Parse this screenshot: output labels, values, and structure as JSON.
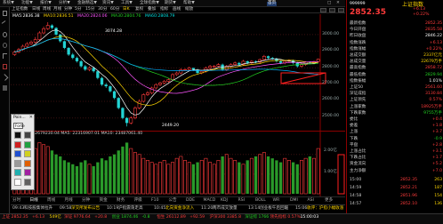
{
  "menu": {
    "items": [
      "系统▼",
      "功能▼",
      "报价▼",
      "分析▼",
      "金融精选▼",
      "资讯▼",
      "工具▼",
      "全球指数▼",
      "期货▼",
      "帮助▼"
    ],
    "active_label": "首页",
    "window_buttons": [
      "□",
      "✕"
    ]
  },
  "toolbar": {
    "stock_label": "上证指数",
    "buttons": [
      "日线",
      "周线",
      "月线",
      "分钟",
      "5分",
      "15分",
      "30分",
      "60分",
      "日K",
      "复权",
      "叠加",
      "指标",
      "画线",
      "缩放"
    ],
    "selected_index": 8
  },
  "main_chart": {
    "header": [
      "MA5:2836.38",
      "MA10:2836.51",
      "MA20:2824.06",
      "MA30:2804.76",
      "MA60:2808.79"
    ],
    "high_label": "3074.28",
    "low_label": "2449.20",
    "price_axis": [
      "3000.00",
      "2900.00",
      "2800.00",
      "2700.00",
      "2600.00",
      "2500.00",
      "2449.20"
    ]
  },
  "volume_chart": {
    "header": "VOLUME: 22679230.04  MA5: 22316907.01  MA10: 23487061.40",
    "axis": [
      "2.00亿",
      "1.00亿"
    ]
  },
  "chart_data": {
    "type": "candlestick",
    "title": "上证指数",
    "ylim": [
      2440,
      3090
    ],
    "open": [
      2880,
      2895,
      2910,
      2930,
      2945,
      2955,
      2970,
      3010,
      3035,
      3055,
      3040,
      3000,
      2960,
      2920,
      2880,
      2860,
      2840,
      2810,
      2790,
      2800,
      2780,
      2740,
      2700,
      2690,
      2660,
      2620,
      2560,
      2500,
      2470,
      2500,
      2560,
      2600,
      2640,
      2650,
      2680,
      2700,
      2710,
      2720,
      2730,
      2760,
      2770,
      2790,
      2790,
      2800,
      2790,
      2770,
      2780,
      2800,
      2810,
      2810,
      2820,
      2790,
      2810,
      2820,
      2830,
      2820,
      2840,
      2830,
      2840,
      2835,
      2850,
      2870,
      2860,
      2855,
      2840,
      2830,
      2840,
      2845,
      2830,
      2810,
      2820,
      2835,
      2830,
      2838
    ],
    "close": [
      2895,
      2910,
      2930,
      2945,
      2955,
      2970,
      3010,
      3035,
      3055,
      3040,
      3000,
      2960,
      2920,
      2880,
      2860,
      2840,
      2810,
      2790,
      2800,
      2780,
      2740,
      2700,
      2690,
      2660,
      2620,
      2560,
      2500,
      2470,
      2500,
      2560,
      2600,
      2640,
      2650,
      2680,
      2700,
      2710,
      2720,
      2730,
      2760,
      2770,
      2790,
      2790,
      2800,
      2790,
      2770,
      2780,
      2800,
      2810,
      2810,
      2820,
      2790,
      2810,
      2820,
      2830,
      2820,
      2840,
      2830,
      2840,
      2835,
      2850,
      2870,
      2860,
      2855,
      2840,
      2830,
      2840,
      2845,
      2830,
      2810,
      2820,
      2835,
      2830,
      2838,
      2852
    ],
    "high": [
      2905,
      2920,
      2940,
      2955,
      2965,
      2985,
      3020,
      3048,
      3074,
      3062,
      3045,
      3005,
      2965,
      2925,
      2890,
      2868,
      2848,
      2818,
      2810,
      2808,
      2785,
      2748,
      2710,
      2695,
      2665,
      2625,
      2565,
      2505,
      2510,
      2570,
      2612,
      2648,
      2662,
      2688,
      2708,
      2718,
      2728,
      2738,
      2768,
      2778,
      2798,
      2798,
      2808,
      2800,
      2795,
      2788,
      2808,
      2818,
      2818,
      2828,
      2826,
      2818,
      2828,
      2838,
      2836,
      2848,
      2844,
      2846,
      2845,
      2856,
      2878,
      2874,
      2866,
      2860,
      2846,
      2846,
      2852,
      2850,
      2836,
      2826,
      2840,
      2840,
      2844,
      2856
    ],
    "low": [
      2872,
      2888,
      2902,
      2922,
      2938,
      2948,
      2962,
      3002,
      3028,
      3032,
      2994,
      2952,
      2912,
      2872,
      2852,
      2832,
      2802,
      2782,
      2780,
      2772,
      2732,
      2692,
      2680,
      2652,
      2612,
      2552,
      2492,
      2449,
      2462,
      2492,
      2552,
      2592,
      2632,
      2642,
      2672,
      2692,
      2702,
      2712,
      2722,
      2752,
      2762,
      2782,
      2782,
      2782,
      2762,
      2762,
      2772,
      2792,
      2802,
      2802,
      2782,
      2782,
      2802,
      2812,
      2812,
      2812,
      2822,
      2822,
      2828,
      2828,
      2842,
      2852,
      2848,
      2832,
      2822,
      2822,
      2832,
      2822,
      2802,
      2802,
      2812,
      2822,
      2822,
      2830
    ],
    "volume": [
      1.6,
      1.7,
      1.8,
      1.9,
      2.1,
      2.3,
      2.6,
      2.5,
      2.4,
      2.2,
      2.0,
      1.9,
      1.7,
      1.6,
      1.5,
      1.4,
      1.6,
      1.7,
      1.5,
      1.4,
      1.6,
      1.8,
      1.7,
      1.9,
      2.0,
      2.2,
      2.4,
      2.6,
      2.3,
      2.1,
      2.0,
      1.8,
      1.7,
      1.6,
      1.5,
      1.6,
      1.7,
      1.5,
      1.6,
      1.8,
      1.9,
      1.7,
      1.6,
      1.5,
      1.6,
      1.7,
      1.8,
      1.6,
      1.5,
      1.7,
      1.9,
      2.0,
      1.8,
      1.7,
      1.6,
      1.5,
      1.7,
      1.8,
      1.9,
      2.0,
      2.1,
      1.9,
      1.8,
      1.7,
      1.6,
      1.8,
      1.7,
      1.6,
      1.5,
      1.7,
      1.8,
      1.9,
      1.8,
      2.3
    ]
  },
  "right_panel": {
    "code": "999999",
    "name": "上证指数",
    "price": "2852.35",
    "change": "+6.13",
    "change_pct": "+0.22%",
    "rows": [
      {
        "k": "最新指数",
        "v": "2852.35",
        "c": "up"
      },
      {
        "k": "今日开盘",
        "v": "2835.58",
        "c": "up"
      },
      {
        "k": "昨日收盘",
        "v": "2846.22",
        "c": "wh"
      },
      {
        "k": "指数涨跌",
        "v": "+6.13",
        "c": "up"
      },
      {
        "k": "指数涨幅",
        "v": "+0.22%",
        "c": "up"
      },
      {
        "k": "总成交额",
        "v": "2337亿元",
        "c": "yl"
      },
      {
        "k": "总成交量",
        "v": "22679万手",
        "c": "yl"
      },
      {
        "k": "最高指数",
        "v": "2858.72",
        "c": "up"
      },
      {
        "k": "最低指数",
        "v": "2829.94",
        "c": "dn"
      },
      {
        "k": "指数振幅",
        "v": "1.01%",
        "c": "wh"
      },
      {
        "k": "上证50",
        "v": "2561.60",
        "c": "up"
      },
      {
        "k": "深证成指",
        "v": "3130.84",
        "c": "up"
      },
      {
        "k": "上证领先",
        "v": "0.57%",
        "c": "up"
      },
      {
        "k": "上涨家数",
        "v": "18925万手",
        "c": "up"
      },
      {
        "k": "下跌家数",
        "v": "9755万手",
        "c": "dn"
      },
      {
        "k": "委比",
        "v": "+0.4",
        "c": "up"
      },
      {
        "k": "委差",
        "v": "+1.8",
        "c": "up"
      },
      {
        "k": "上涨",
        "v": "+3.7",
        "c": "up"
      },
      {
        "k": "下跌",
        "v": "-0.9",
        "c": "dn"
      },
      {
        "k": "平盘",
        "v": "+2.8",
        "c": "up"
      },
      {
        "k": "上涨占比",
        "v": "+3.1",
        "c": "up"
      },
      {
        "k": "下跌占比",
        "v": "+1.7",
        "c": "up"
      },
      {
        "k": "资金流向",
        "v": "+5.2",
        "c": "up"
      },
      {
        "k": "主力净额",
        "v": "+7.0",
        "c": "up"
      }
    ],
    "ticks": [
      {
        "t": "15:00",
        "p": "2852.35",
        "v": "263"
      },
      {
        "t": "14:59",
        "p": "2852.21",
        "v": "187"
      },
      {
        "t": "14:58",
        "p": "2851.96",
        "v": "154"
      },
      {
        "t": "14:57",
        "p": "2852.10",
        "v": "136"
      }
    ]
  },
  "popup": {
    "title": "Poin...",
    "close": "✕",
    "field": "Forte",
    "swatch_colors": [
      "#111111",
      "#444444",
      "#d02020",
      "#20a040",
      "#2050d0",
      "#d0d020",
      "#9a9a9a",
      "#e06000",
      "#20b0b0",
      "#a020a0",
      "#ffffff",
      "#606060"
    ]
  },
  "tabs": [
    "分时",
    "日线",
    "周线",
    "月线",
    "分钟",
    "资金",
    "财务",
    "评级",
    "F10",
    "公告",
    "DDE",
    "MACD",
    "KDJ",
    "RSI",
    "BOLL",
    "WR",
    "DMI",
    "ASI",
    "更多"
  ],
  "news": [
    {
      "t": "09:43",
      "text": "科技股集体拉升",
      "hl": false
    },
    {
      "t": "09:58",
      "text": "深交所发布公告",
      "hl": true
    },
    {
      "t": "10:19",
      "text": "沪指震荡走高",
      "hl": false
    },
    {
      "t": "10:45",
      "text": "北向资金净流入",
      "hl": true
    },
    {
      "t": "11:20",
      "text": "两市成交放量",
      "hl": false
    },
    {
      "t": "13:14",
      "text": "创业板午后回暖",
      "hl": false
    },
    {
      "t": "15:06",
      "text": "收评：沪指小幅收涨",
      "hl": true
    }
  ],
  "status": [
    {
      "text": "上证 2852.35",
      "c": "up"
    },
    {
      "text": "+6.13",
      "c": "up"
    },
    {
      "text": "549亿",
      "c": "yl"
    },
    {
      "text": "深证 9776.64",
      "c": "up"
    },
    {
      "text": "+20.8",
      "c": "up"
    },
    {
      "text": "创业 1874.46",
      "c": "dn"
    },
    {
      "text": "-0.8",
      "c": "dn"
    },
    {
      "text": "恒生 26112.89",
      "c": "up"
    },
    {
      "text": "+92.59",
      "c": "up"
    },
    {
      "text": "沪深300 3385.8",
      "c": "up"
    },
    {
      "text": "深证综 1766",
      "c": "dn"
    },
    {
      "text": "领先指标 0.57%",
      "c": "up"
    },
    {
      "text": "15:00:03",
      "c": "wh"
    }
  ]
}
